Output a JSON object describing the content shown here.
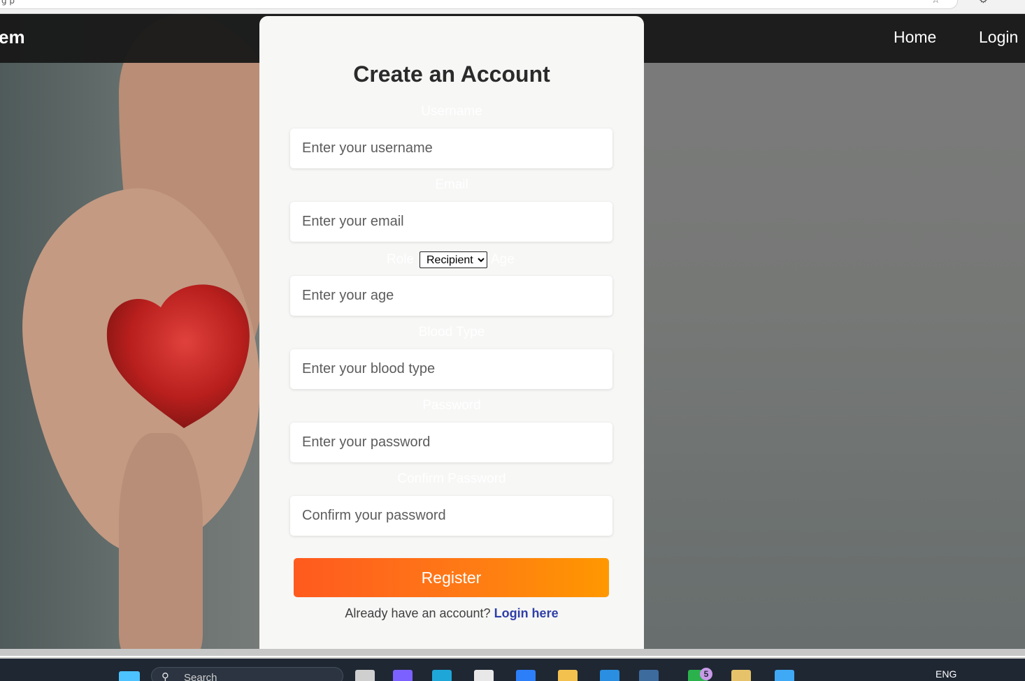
{
  "browser": {
    "url_fragment": "g   p",
    "star_icon": "☆",
    "gear_icon": "⚙"
  },
  "navbar": {
    "brand": "em",
    "links": {
      "home": "Home",
      "login": "Login"
    }
  },
  "form": {
    "title": "Create an Account",
    "username": {
      "label": "Username",
      "placeholder": "Enter your username"
    },
    "email": {
      "label": "Email",
      "placeholder": "Enter your email"
    },
    "role": {
      "label": "Role",
      "selected": "Recipient"
    },
    "age": {
      "label": "Age",
      "placeholder": "Enter your age"
    },
    "blood_type": {
      "label": "Blood Type",
      "placeholder": "Enter your blood type"
    },
    "password": {
      "label": "Password",
      "placeholder": "Enter your password"
    },
    "confirm_password": {
      "label": "Confirm Password",
      "placeholder": "Confirm your password"
    },
    "register_label": "Register",
    "login_prompt": "Already have an account?",
    "login_link": "Login here"
  },
  "colors": {
    "accent_start": "#ff5a1f",
    "accent_end": "#ff9800",
    "link": "#2f3fa8",
    "navbar": "#191919"
  },
  "taskbar": {
    "search_text": "Search",
    "search_icon": "⚲",
    "language": "ENG",
    "notification_count": "5"
  }
}
